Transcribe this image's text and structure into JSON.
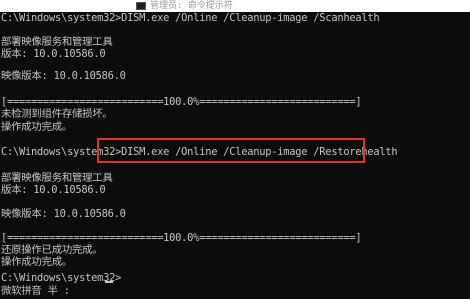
{
  "window": {
    "title": "管理员: 命令提示符"
  },
  "console": {
    "lines": [
      "C:\\Windows\\system32>DISM.exe /Online /Cleanup-image /Scanhealth",
      "",
      "部署映像服务和管理工具",
      "版本: 10.0.10586.0",
      "",
      "映像版本: 10.0.10586.0",
      "",
      "[==========================100.0%==========================]",
      "未检测到组件存储损坏。",
      "操作成功完成。",
      "",
      "C:\\Windows\\system32>DISM.exe /Online /Cleanup-image /Restorehealth",
      "",
      "部署映像服务和管理工具",
      "版本: 10.0.10586.0",
      "",
      "映像版本: 10.0.10586.0",
      "",
      "[==========================100.0%==========================]",
      "还原操作已成功完成。",
      "操作成功完成。",
      "",
      "C:\\Windows\\system32>",
      "微软拼音 半 :"
    ]
  },
  "colors": {
    "background": "#0c0c0c",
    "text": "#c6c6c6",
    "highlight": "#e5312c"
  }
}
